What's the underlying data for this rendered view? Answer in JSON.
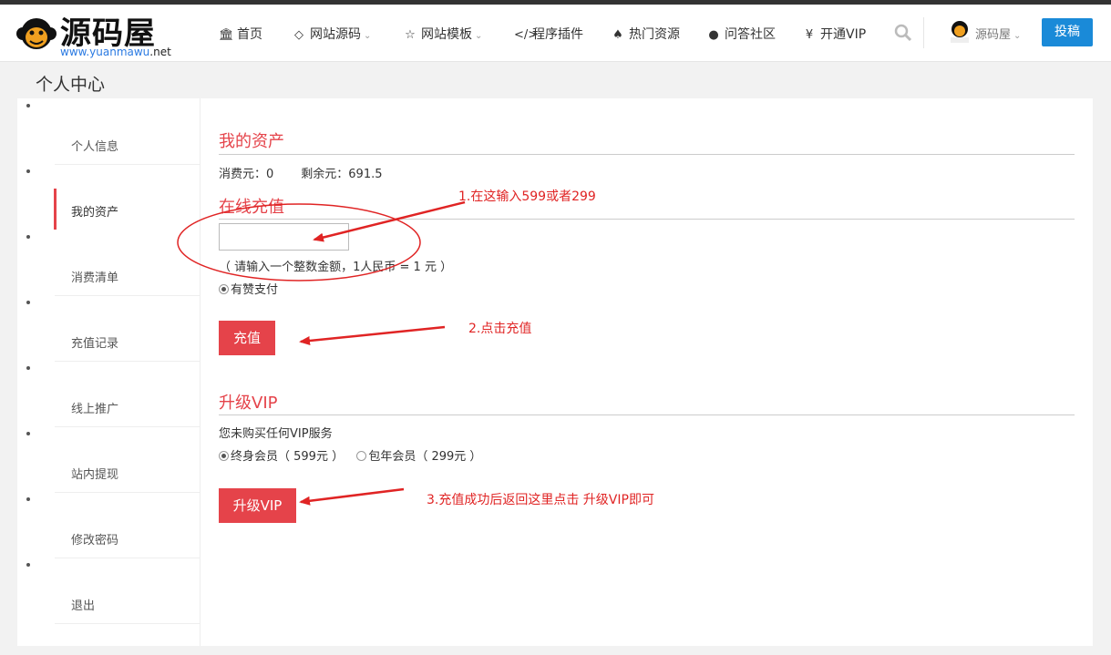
{
  "logo": {
    "brand": "源码屋",
    "domain_prefix": "www.",
    "domain_mid": "yuanmawu",
    "domain_suffix": ".net"
  },
  "nav": [
    {
      "label": "首页",
      "icon": "bank-icon"
    },
    {
      "label": "网站源码",
      "icon": "diamond-icon",
      "dropdown": true
    },
    {
      "label": "网站模板",
      "icon": "star-half-icon",
      "dropdown": true
    },
    {
      "label": "程序插件",
      "icon": "code-icon"
    },
    {
      "label": "热门资源",
      "icon": "fire-icon"
    },
    {
      "label": "问答社区",
      "icon": "comment-icon"
    },
    {
      "label": "开通VIP",
      "icon": "yen-icon"
    }
  ],
  "user": {
    "name": "源码屋"
  },
  "post_button": "投稿",
  "page_title": "个人中心",
  "sidebar": [
    {
      "label": "个人信息"
    },
    {
      "label": "我的资产",
      "active": true
    },
    {
      "label": "消费清单"
    },
    {
      "label": "充值记录"
    },
    {
      "label": "线上推广"
    },
    {
      "label": "站内提现"
    },
    {
      "label": "修改密码"
    },
    {
      "label": "退出"
    }
  ],
  "assets": {
    "title": "我的资产",
    "consumed": "消费元：0",
    "remaining": "剩余元：691.5"
  },
  "recharge": {
    "title": "在线充值",
    "input_value": "",
    "hint": "（ 请输入一个整数金额，1人民币 = 1 元 ）",
    "payment_option": "有赞支付",
    "button": "充值"
  },
  "vip": {
    "title": "升级VIP",
    "status": "您未购买任何VIP服务",
    "option_lifetime": "终身会员（ 599元 ）",
    "option_year": "包年会员（ 299元 ）",
    "button": "升级VIP"
  },
  "annotations": {
    "step1": "1.在这输入599或者299",
    "step2": "2.点击充值",
    "step3": "3.充值成功后返回这里点击 升级VIP即可"
  },
  "colors": {
    "accent_red": "#e5434a",
    "annotation_red": "#e02424",
    "post_blue": "#1a8ad8"
  }
}
